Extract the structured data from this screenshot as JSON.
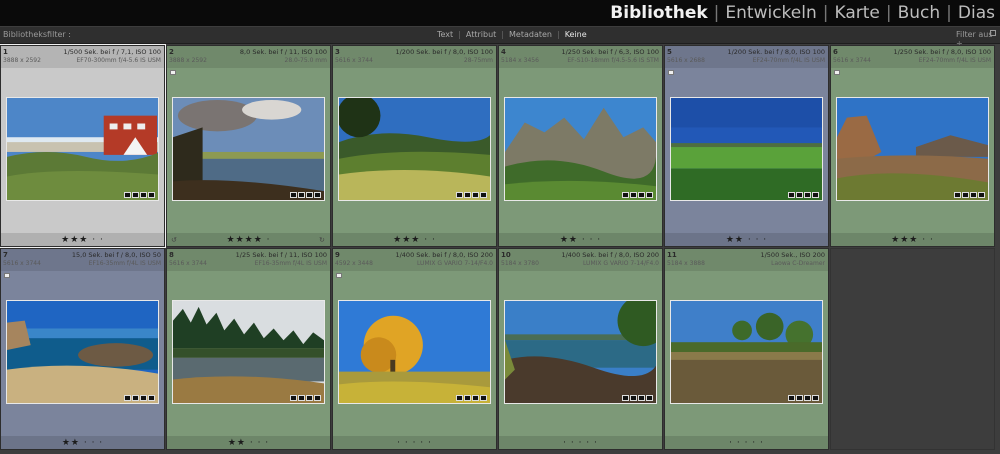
{
  "modules": {
    "items": [
      {
        "label": "Bibliothek",
        "active": true
      },
      {
        "label": "Entwickeln",
        "active": false
      },
      {
        "label": "Karte",
        "active": false
      },
      {
        "label": "Buch",
        "active": false
      },
      {
        "label": "Dias",
        "active": false
      }
    ],
    "separator": "|"
  },
  "filterbar": {
    "title": "Bibliotheksfilter :",
    "tabs": [
      {
        "label": "Text",
        "selected": false
      },
      {
        "label": "Attribut",
        "selected": false
      },
      {
        "label": "Metadaten",
        "selected": false
      },
      {
        "label": "Keine",
        "selected": true
      }
    ],
    "preset_label": "Filter aus ÷"
  },
  "colors": {
    "gray": "#c9c9c9",
    "green": "#7d9978",
    "blue": "#7b849c",
    "empty": "#3d3d3d"
  },
  "photos": [
    {
      "index": "1",
      "exposure": "1/500 Sek. bei f / 7,1, ISO 100",
      "dims": "3888 x 2592",
      "lens": "EF70-300mm f/4-5.6 IS USM",
      "rating": 3,
      "label": "gray",
      "flag": false,
      "selected": true,
      "scene": "beach"
    },
    {
      "index": "2",
      "exposure": "8,0 Sek. bei f / 11, ISO 100",
      "dims": "3888 x 2592",
      "lens": "28.0-75.0 mm",
      "rating": 4,
      "label": "green",
      "flag": true,
      "selected": false,
      "scene": "river"
    },
    {
      "index": "3",
      "exposure": "1/200 Sek. bei f / 8,0, ISO 100",
      "dims": "5616 x 3744",
      "lens": "28-75mm",
      "rating": 3,
      "label": "green",
      "flag": false,
      "selected": false,
      "scene": "hills"
    },
    {
      "index": "4",
      "exposure": "1/250 Sek. bei f / 6,3, ISO 100",
      "dims": "5184 x 3456",
      "lens": "EF-S10-18mm f/4.5-5.6 IS STM",
      "rating": 2,
      "label": "green",
      "flag": false,
      "selected": false,
      "scene": "peaks"
    },
    {
      "index": "5",
      "exposure": "1/200 Sek. bei f / 8,0, ISO 100",
      "dims": "5616 x 2688",
      "lens": "EF24-70mm f/4L IS USM",
      "rating": 2,
      "label": "blue",
      "flag": true,
      "selected": false,
      "scene": "meadow"
    },
    {
      "index": "6",
      "exposure": "1/250 Sek. bei f / 8,0, ISO 100",
      "dims": "5616 x 3744",
      "lens": "EF24-70mm f/4L IS USM",
      "rating": 3,
      "label": "green",
      "flag": true,
      "selected": false,
      "scene": "volcano"
    },
    {
      "index": "7",
      "exposure": "15,0 Sek. bei f / 8,0, ISO 50",
      "dims": "5616 x 3744",
      "lens": "EF16-35mm f/4L IS USM",
      "rating": 2,
      "label": "blue",
      "flag": true,
      "selected": false,
      "scene": "coast"
    },
    {
      "index": "8",
      "exposure": "1/25 Sek. bei f / 11, ISO 100",
      "dims": "5616 x 3744",
      "lens": "EF16-35mm f/4L IS USM",
      "rating": 2,
      "label": "green",
      "flag": false,
      "selected": false,
      "scene": "forest"
    },
    {
      "index": "9",
      "exposure": "1/400 Sek. bei f / 8,0, ISO 200",
      "dims": "4592 x 3448",
      "lens": "LUMIX G VARIO 7-14/F4.0",
      "rating": 0,
      "label": "green",
      "flag": true,
      "selected": false,
      "scene": "tree"
    },
    {
      "index": "10",
      "exposure": "1/400 Sek. bei f / 8,0, ISO 200",
      "dims": "5184 x 3780",
      "lens": "LUMIX G VARIO 7-14/F4.0",
      "rating": 0,
      "label": "green",
      "flag": false,
      "selected": false,
      "scene": "lake"
    },
    {
      "index": "11",
      "exposure": "1/500 Sek., ISO 200",
      "dims": "5184 x 3888",
      "lens": "Laowa C-Dreamer",
      "rating": 0,
      "label": "green",
      "flag": false,
      "selected": false,
      "scene": "pond"
    }
  ]
}
